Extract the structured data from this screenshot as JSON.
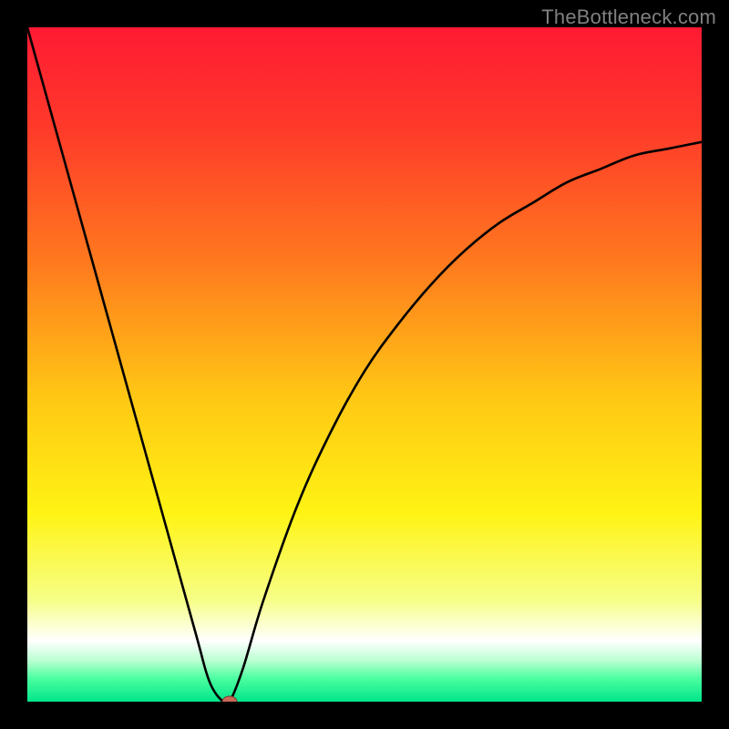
{
  "attribution": "TheBottleneck.com",
  "chart_data": {
    "type": "line",
    "title": "",
    "xlabel": "",
    "ylabel": "",
    "xlim": [
      0,
      100
    ],
    "ylim": [
      0,
      100
    ],
    "x": [
      0,
      5,
      10,
      15,
      20,
      25,
      27,
      29,
      30,
      32,
      35,
      40,
      45,
      50,
      55,
      60,
      65,
      70,
      75,
      80,
      85,
      90,
      95,
      100
    ],
    "values": [
      100,
      82,
      64,
      46,
      28,
      10,
      3,
      0,
      0,
      5,
      15,
      29,
      40,
      49,
      56,
      62,
      67,
      71,
      74,
      77,
      79,
      81,
      82,
      83
    ],
    "marker": {
      "x": 30,
      "y": 0
    },
    "background_gradient": [
      {
        "pos": 0.0,
        "color": "#ff1a33"
      },
      {
        "pos": 0.15,
        "color": "#ff3a2a"
      },
      {
        "pos": 0.35,
        "color": "#ff7a1e"
      },
      {
        "pos": 0.55,
        "color": "#ffc814"
      },
      {
        "pos": 0.72,
        "color": "#fff314"
      },
      {
        "pos": 0.85,
        "color": "#f6ff88"
      },
      {
        "pos": 0.91,
        "color": "#ffffff"
      },
      {
        "pos": 0.94,
        "color": "#b8ffd0"
      },
      {
        "pos": 0.965,
        "color": "#4dffa0"
      },
      {
        "pos": 1.0,
        "color": "#00e58a"
      }
    ],
    "colors": {
      "curve": "#000000",
      "marker_fill": "#c96a5a",
      "marker_stroke": "#7a3a30"
    }
  }
}
